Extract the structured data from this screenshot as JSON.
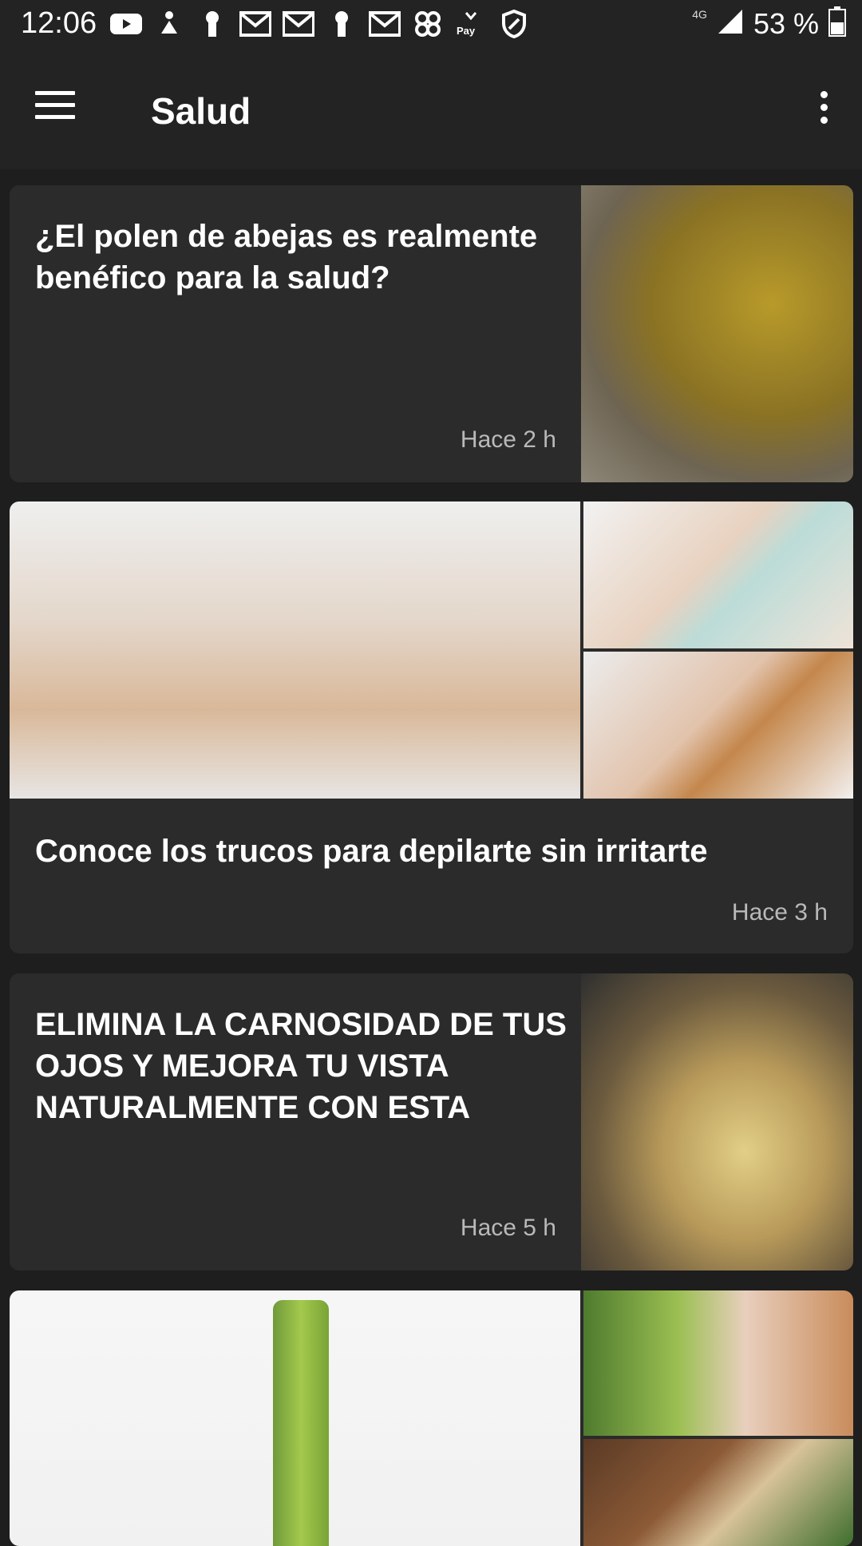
{
  "status_bar": {
    "time": "12:06",
    "network": "4G",
    "battery": "53 %",
    "notification_icons": [
      "youtube-icon",
      "horoscope-icon",
      "keyhole-icon",
      "gmail-icon",
      "gmail-icon",
      "keyhole-icon",
      "gmail-icon",
      "pinwheel-icon",
      "caixa-pay-icon",
      "shield-icon"
    ]
  },
  "app_bar": {
    "title": "Salud"
  },
  "feed": {
    "items": [
      {
        "title": "¿El polen de abejas es realmente benéfico para la salud?",
        "time": "Hace 2 h"
      },
      {
        "title": "Conoce los trucos para depilarte sin irritarte",
        "time": "Hace 3 h"
      },
      {
        "title": "ELIMINA LA CARNOSIDAD DE TUS OJOS Y MEJORA TU VISTA NATURALMENTE CON ESTA",
        "time": "Hace 5 h"
      },
      {
        "title": "",
        "time": ""
      }
    ]
  },
  "colors": {
    "background": "#1e1e1e",
    "app_bar": "#232323",
    "card": "#2b2b2b",
    "secondary_text": "#b9b9b9"
  }
}
